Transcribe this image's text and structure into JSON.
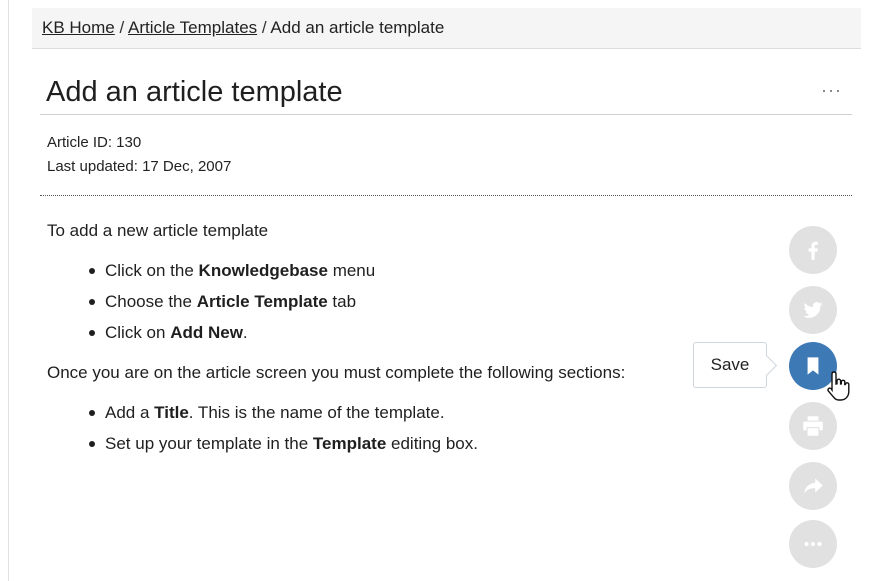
{
  "breadcrumb": {
    "home": "KB Home",
    "separator": "/",
    "section": "Article Templates",
    "current": "Add an article template"
  },
  "article": {
    "title": "Add an article template",
    "more_menu": "···",
    "id_line": "Article ID: 130",
    "updated_line": "Last updated: 17 Dec, 2007",
    "intro": "To add a new article template",
    "steps": [
      {
        "pre": "Click on the ",
        "bold": "Knowledgebase",
        "post": " menu"
      },
      {
        "pre": "Choose the ",
        "bold": "Article Template",
        "post": " tab"
      },
      {
        "pre": "Click on ",
        "bold": "Add New",
        "post": "."
      }
    ],
    "followup": "Once you are on the article screen you must complete the following sections:",
    "sections": [
      {
        "pre": "Add a ",
        "bold": "Title",
        "post": ". This is the name of the template."
      },
      {
        "pre": "Set up your template in the ",
        "bold": "Template",
        "post": " editing box."
      }
    ]
  },
  "share_bar": {
    "buttons": [
      "facebook-icon",
      "twitter-icon",
      "bookmark-icon",
      "print-icon",
      "share-arrow-icon",
      "more-dots-icon"
    ],
    "active": "bookmark-icon",
    "tooltip": "Save",
    "colors": {
      "inactive": "#e1e1e1",
      "active": "#3d79b5",
      "icon": "#ffffff"
    }
  }
}
